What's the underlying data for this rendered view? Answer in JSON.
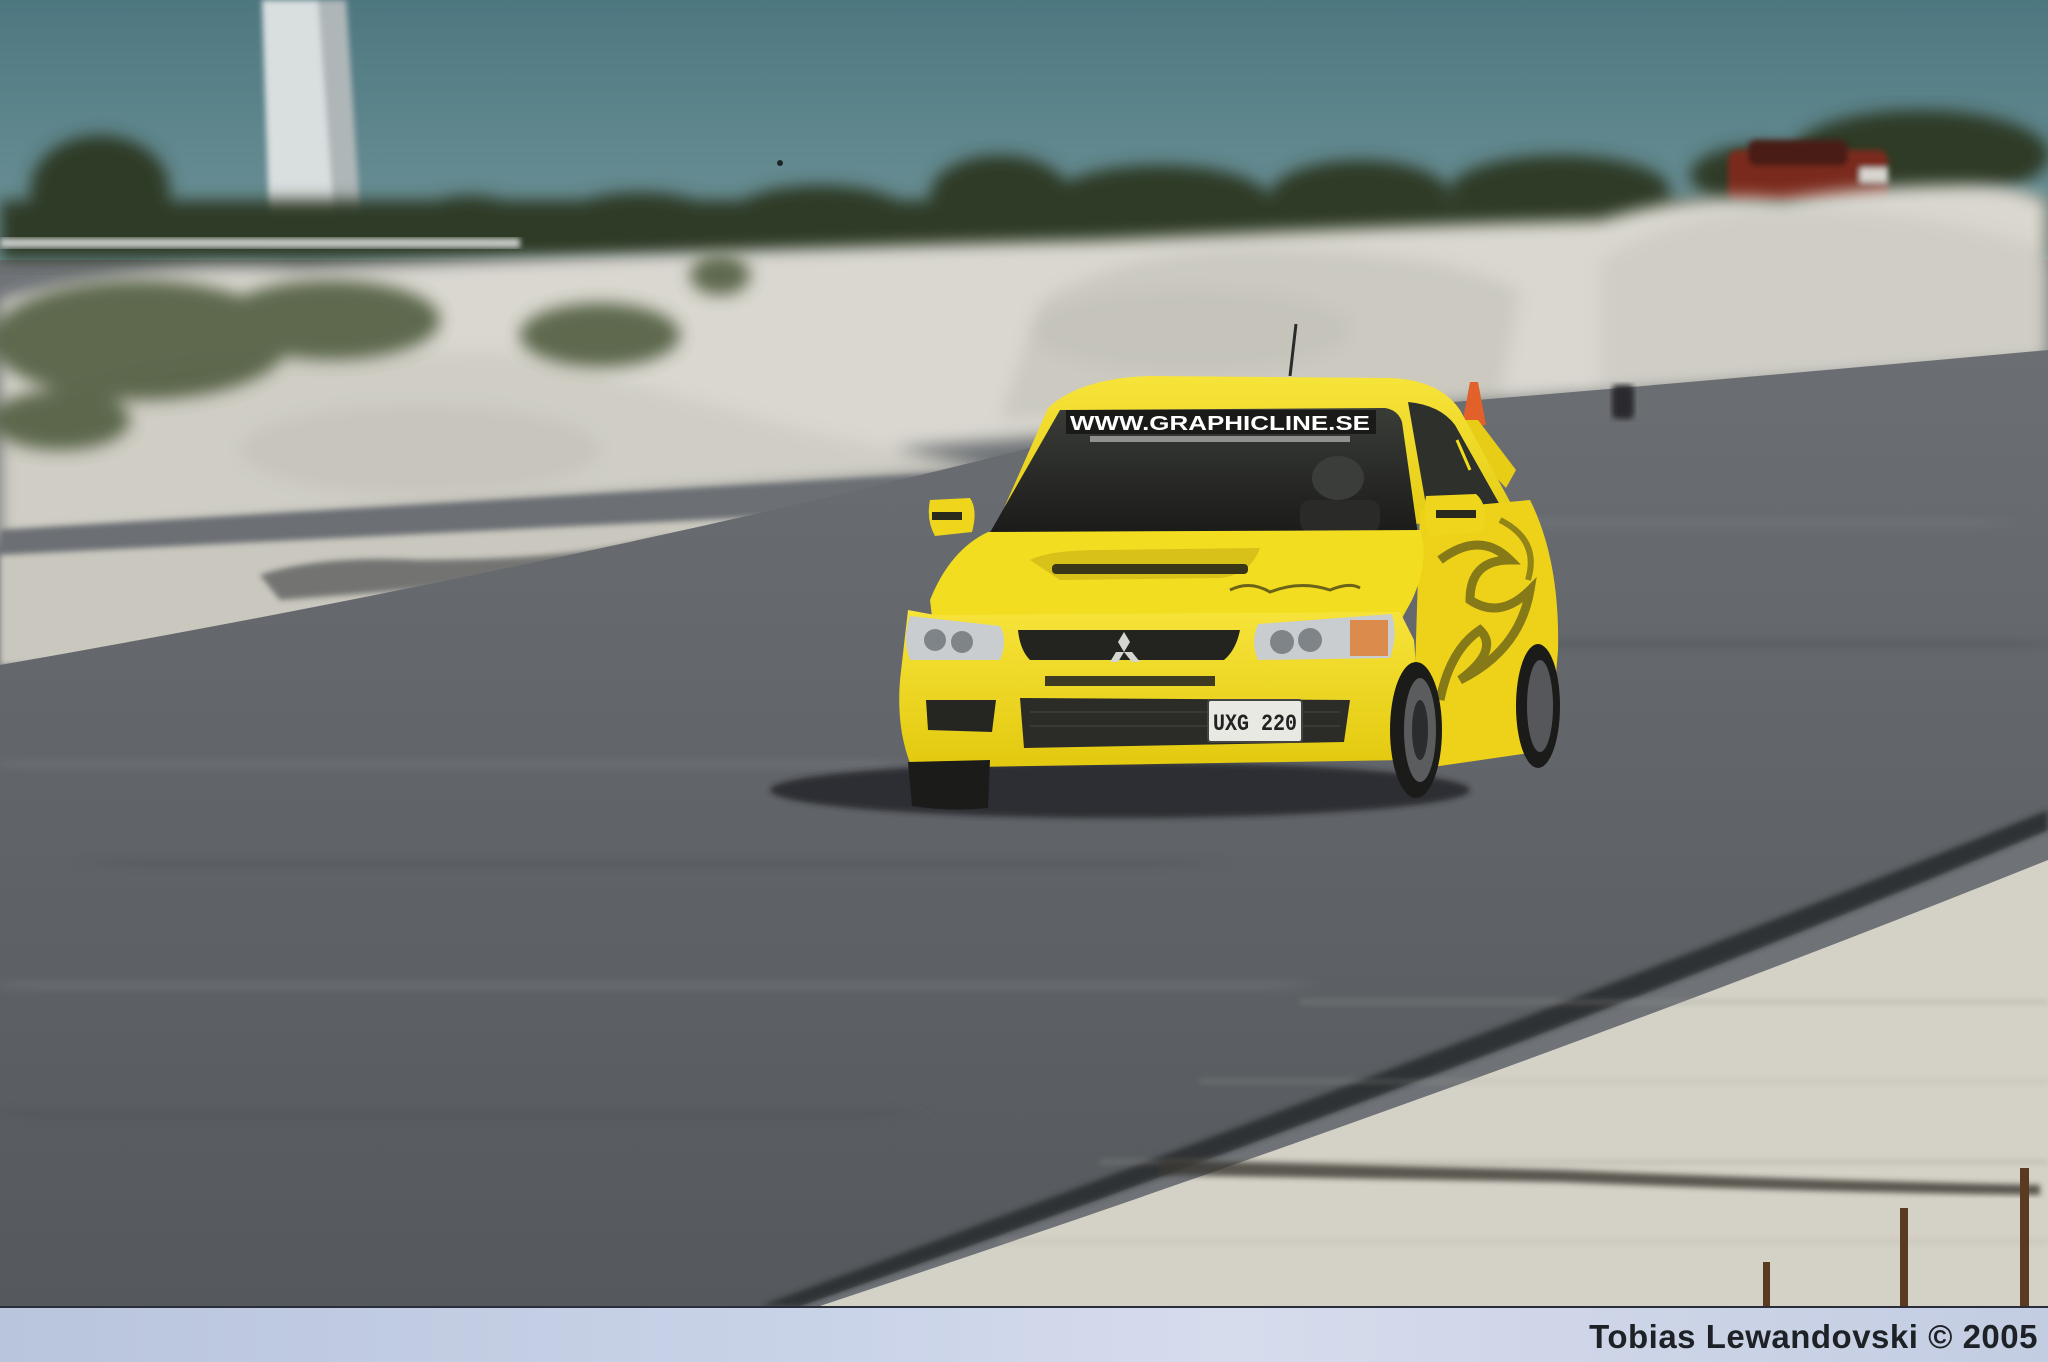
{
  "photo": {
    "credit": "Tobias Lewandovski © 2005",
    "windshield_banner": "WWW.GRAPHICLINE.SE",
    "license_plate": "UXG 220",
    "colors": {
      "sky": "#4f7c86",
      "car_body": "#f2dc1a",
      "asphalt": "#5d6166",
      "gravel": "#d9d7cf"
    }
  }
}
